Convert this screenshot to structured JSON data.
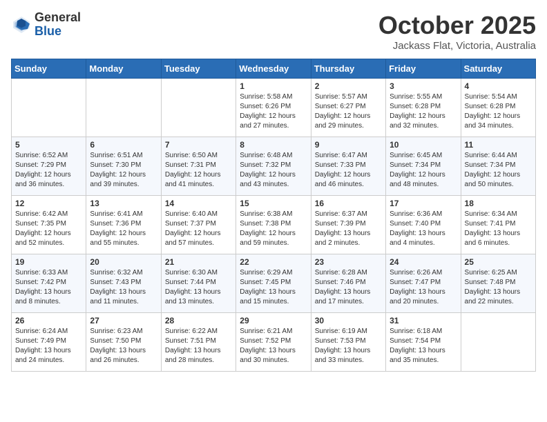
{
  "header": {
    "logo_general": "General",
    "logo_blue": "Blue",
    "month_title": "October 2025",
    "location": "Jackass Flat, Victoria, Australia"
  },
  "days_of_week": [
    "Sunday",
    "Monday",
    "Tuesday",
    "Wednesday",
    "Thursday",
    "Friday",
    "Saturday"
  ],
  "weeks": [
    [
      {
        "day": "",
        "sunrise": "",
        "sunset": "",
        "daylight": ""
      },
      {
        "day": "",
        "sunrise": "",
        "sunset": "",
        "daylight": ""
      },
      {
        "day": "",
        "sunrise": "",
        "sunset": "",
        "daylight": ""
      },
      {
        "day": "1",
        "sunrise": "Sunrise: 5:58 AM",
        "sunset": "Sunset: 6:26 PM",
        "daylight": "Daylight: 12 hours and 27 minutes."
      },
      {
        "day": "2",
        "sunrise": "Sunrise: 5:57 AM",
        "sunset": "Sunset: 6:27 PM",
        "daylight": "Daylight: 12 hours and 29 minutes."
      },
      {
        "day": "3",
        "sunrise": "Sunrise: 5:55 AM",
        "sunset": "Sunset: 6:28 PM",
        "daylight": "Daylight: 12 hours and 32 minutes."
      },
      {
        "day": "4",
        "sunrise": "Sunrise: 5:54 AM",
        "sunset": "Sunset: 6:28 PM",
        "daylight": "Daylight: 12 hours and 34 minutes."
      }
    ],
    [
      {
        "day": "5",
        "sunrise": "Sunrise: 6:52 AM",
        "sunset": "Sunset: 7:29 PM",
        "daylight": "Daylight: 12 hours and 36 minutes."
      },
      {
        "day": "6",
        "sunrise": "Sunrise: 6:51 AM",
        "sunset": "Sunset: 7:30 PM",
        "daylight": "Daylight: 12 hours and 39 minutes."
      },
      {
        "day": "7",
        "sunrise": "Sunrise: 6:50 AM",
        "sunset": "Sunset: 7:31 PM",
        "daylight": "Daylight: 12 hours and 41 minutes."
      },
      {
        "day": "8",
        "sunrise": "Sunrise: 6:48 AM",
        "sunset": "Sunset: 7:32 PM",
        "daylight": "Daylight: 12 hours and 43 minutes."
      },
      {
        "day": "9",
        "sunrise": "Sunrise: 6:47 AM",
        "sunset": "Sunset: 7:33 PM",
        "daylight": "Daylight: 12 hours and 46 minutes."
      },
      {
        "day": "10",
        "sunrise": "Sunrise: 6:45 AM",
        "sunset": "Sunset: 7:34 PM",
        "daylight": "Daylight: 12 hours and 48 minutes."
      },
      {
        "day": "11",
        "sunrise": "Sunrise: 6:44 AM",
        "sunset": "Sunset: 7:34 PM",
        "daylight": "Daylight: 12 hours and 50 minutes."
      }
    ],
    [
      {
        "day": "12",
        "sunrise": "Sunrise: 6:42 AM",
        "sunset": "Sunset: 7:35 PM",
        "daylight": "Daylight: 12 hours and 52 minutes."
      },
      {
        "day": "13",
        "sunrise": "Sunrise: 6:41 AM",
        "sunset": "Sunset: 7:36 PM",
        "daylight": "Daylight: 12 hours and 55 minutes."
      },
      {
        "day": "14",
        "sunrise": "Sunrise: 6:40 AM",
        "sunset": "Sunset: 7:37 PM",
        "daylight": "Daylight: 12 hours and 57 minutes."
      },
      {
        "day": "15",
        "sunrise": "Sunrise: 6:38 AM",
        "sunset": "Sunset: 7:38 PM",
        "daylight": "Daylight: 12 hours and 59 minutes."
      },
      {
        "day": "16",
        "sunrise": "Sunrise: 6:37 AM",
        "sunset": "Sunset: 7:39 PM",
        "daylight": "Daylight: 13 hours and 2 minutes."
      },
      {
        "day": "17",
        "sunrise": "Sunrise: 6:36 AM",
        "sunset": "Sunset: 7:40 PM",
        "daylight": "Daylight: 13 hours and 4 minutes."
      },
      {
        "day": "18",
        "sunrise": "Sunrise: 6:34 AM",
        "sunset": "Sunset: 7:41 PM",
        "daylight": "Daylight: 13 hours and 6 minutes."
      }
    ],
    [
      {
        "day": "19",
        "sunrise": "Sunrise: 6:33 AM",
        "sunset": "Sunset: 7:42 PM",
        "daylight": "Daylight: 13 hours and 8 minutes."
      },
      {
        "day": "20",
        "sunrise": "Sunrise: 6:32 AM",
        "sunset": "Sunset: 7:43 PM",
        "daylight": "Daylight: 13 hours and 11 minutes."
      },
      {
        "day": "21",
        "sunrise": "Sunrise: 6:30 AM",
        "sunset": "Sunset: 7:44 PM",
        "daylight": "Daylight: 13 hours and 13 minutes."
      },
      {
        "day": "22",
        "sunrise": "Sunrise: 6:29 AM",
        "sunset": "Sunset: 7:45 PM",
        "daylight": "Daylight: 13 hours and 15 minutes."
      },
      {
        "day": "23",
        "sunrise": "Sunrise: 6:28 AM",
        "sunset": "Sunset: 7:46 PM",
        "daylight": "Daylight: 13 hours and 17 minutes."
      },
      {
        "day": "24",
        "sunrise": "Sunrise: 6:26 AM",
        "sunset": "Sunset: 7:47 PM",
        "daylight": "Daylight: 13 hours and 20 minutes."
      },
      {
        "day": "25",
        "sunrise": "Sunrise: 6:25 AM",
        "sunset": "Sunset: 7:48 PM",
        "daylight": "Daylight: 13 hours and 22 minutes."
      }
    ],
    [
      {
        "day": "26",
        "sunrise": "Sunrise: 6:24 AM",
        "sunset": "Sunset: 7:49 PM",
        "daylight": "Daylight: 13 hours and 24 minutes."
      },
      {
        "day": "27",
        "sunrise": "Sunrise: 6:23 AM",
        "sunset": "Sunset: 7:50 PM",
        "daylight": "Daylight: 13 hours and 26 minutes."
      },
      {
        "day": "28",
        "sunrise": "Sunrise: 6:22 AM",
        "sunset": "Sunset: 7:51 PM",
        "daylight": "Daylight: 13 hours and 28 minutes."
      },
      {
        "day": "29",
        "sunrise": "Sunrise: 6:21 AM",
        "sunset": "Sunset: 7:52 PM",
        "daylight": "Daylight: 13 hours and 30 minutes."
      },
      {
        "day": "30",
        "sunrise": "Sunrise: 6:19 AM",
        "sunset": "Sunset: 7:53 PM",
        "daylight": "Daylight: 13 hours and 33 minutes."
      },
      {
        "day": "31",
        "sunrise": "Sunrise: 6:18 AM",
        "sunset": "Sunset: 7:54 PM",
        "daylight": "Daylight: 13 hours and 35 minutes."
      },
      {
        "day": "",
        "sunrise": "",
        "sunset": "",
        "daylight": ""
      }
    ]
  ]
}
